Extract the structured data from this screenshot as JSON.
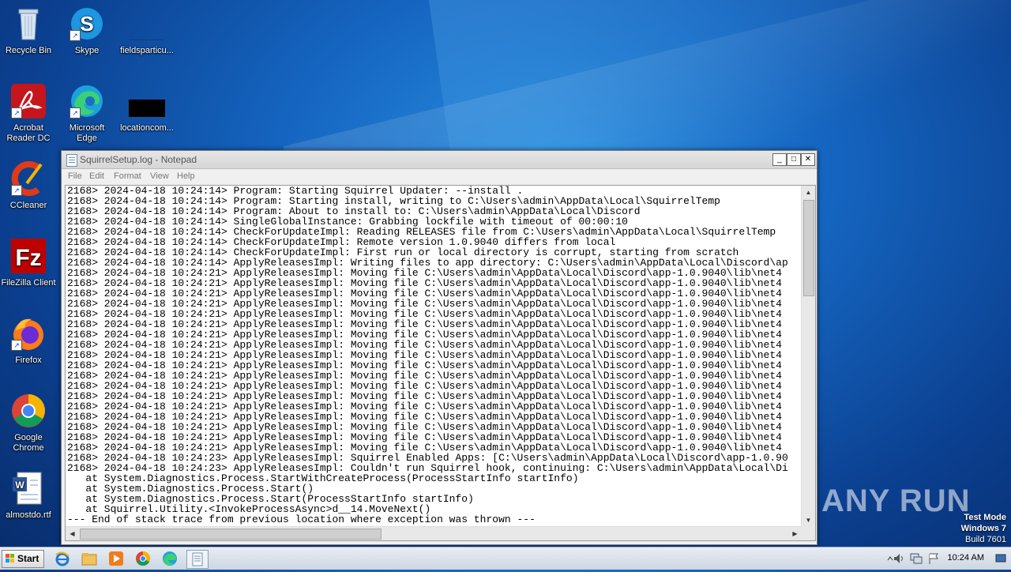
{
  "desktop_icons": [
    {
      "label": "Recycle Bin",
      "icon": "recycle-bin-icon"
    },
    {
      "label": "Skype",
      "icon": "skype-icon"
    },
    {
      "label": "fieldsparticu...",
      "icon": "file-icon"
    },
    {
      "label": "Acrobat Reader DC",
      "icon": "acrobat-icon"
    },
    {
      "label": "Microsoft Edge",
      "icon": "edge-icon"
    },
    {
      "label": "locationcom...",
      "icon": "file-icon"
    },
    {
      "label": "CCleaner",
      "icon": "ccleaner-icon"
    },
    {
      "label": "FileZilla Client",
      "icon": "filezilla-icon"
    },
    {
      "label": "Firefox",
      "icon": "firefox-icon"
    },
    {
      "label": "Google Chrome",
      "icon": "chrome-icon"
    },
    {
      "label": "almostdo.rtf",
      "icon": "word-doc-icon"
    }
  ],
  "notepad": {
    "title": "SquirrelSetup.log - Notepad",
    "menu": [
      "File",
      "Edit",
      "Format",
      "View",
      "Help"
    ],
    "buttons": {
      "minimize": "_",
      "maximize": "□",
      "close": "✕"
    },
    "lines": [
      "2168> 2024-04-18 10:24:14> Program: Starting Squirrel Updater: --install .",
      "2168> 2024-04-18 10:24:14> Program: Starting install, writing to C:\\Users\\admin\\AppData\\Local\\SquirrelTemp",
      "2168> 2024-04-18 10:24:14> Program: About to install to: C:\\Users\\admin\\AppData\\Local\\Discord",
      "2168> 2024-04-18 10:24:14> SingleGlobalInstance: Grabbing lockfile with timeout of 00:00:10",
      "2168> 2024-04-18 10:24:14> CheckForUpdateImpl: Reading RELEASES file from C:\\Users\\admin\\AppData\\Local\\SquirrelTemp",
      "2168> 2024-04-18 10:24:14> CheckForUpdateImpl: Remote version 1.0.9040 differs from local",
      "2168> 2024-04-18 10:24:14> CheckForUpdateImpl: First run or local directory is corrupt, starting from scratch",
      "2168> 2024-04-18 10:24:14> ApplyReleasesImpl: Writing files to app directory: C:\\Users\\admin\\AppData\\Local\\Discord\\ap",
      "2168> 2024-04-18 10:24:21> ApplyReleasesImpl: Moving file C:\\Users\\admin\\AppData\\Local\\Discord\\app-1.0.9040\\lib\\net4",
      "2168> 2024-04-18 10:24:21> ApplyReleasesImpl: Moving file C:\\Users\\admin\\AppData\\Local\\Discord\\app-1.0.9040\\lib\\net4",
      "2168> 2024-04-18 10:24:21> ApplyReleasesImpl: Moving file C:\\Users\\admin\\AppData\\Local\\Discord\\app-1.0.9040\\lib\\net4",
      "2168> 2024-04-18 10:24:21> ApplyReleasesImpl: Moving file C:\\Users\\admin\\AppData\\Local\\Discord\\app-1.0.9040\\lib\\net4",
      "2168> 2024-04-18 10:24:21> ApplyReleasesImpl: Moving file C:\\Users\\admin\\AppData\\Local\\Discord\\app-1.0.9040\\lib\\net4",
      "2168> 2024-04-18 10:24:21> ApplyReleasesImpl: Moving file C:\\Users\\admin\\AppData\\Local\\Discord\\app-1.0.9040\\lib\\net4",
      "2168> 2024-04-18 10:24:21> ApplyReleasesImpl: Moving file C:\\Users\\admin\\AppData\\Local\\Discord\\app-1.0.9040\\lib\\net4",
      "2168> 2024-04-18 10:24:21> ApplyReleasesImpl: Moving file C:\\Users\\admin\\AppData\\Local\\Discord\\app-1.0.9040\\lib\\net4",
      "2168> 2024-04-18 10:24:21> ApplyReleasesImpl: Moving file C:\\Users\\admin\\AppData\\Local\\Discord\\app-1.0.9040\\lib\\net4",
      "2168> 2024-04-18 10:24:21> ApplyReleasesImpl: Moving file C:\\Users\\admin\\AppData\\Local\\Discord\\app-1.0.9040\\lib\\net4",
      "2168> 2024-04-18 10:24:21> ApplyReleasesImpl: Moving file C:\\Users\\admin\\AppData\\Local\\Discord\\app-1.0.9040\\lib\\net4",
      "2168> 2024-04-18 10:24:21> ApplyReleasesImpl: Moving file C:\\Users\\admin\\AppData\\Local\\Discord\\app-1.0.9040\\lib\\net4",
      "2168> 2024-04-18 10:24:21> ApplyReleasesImpl: Moving file C:\\Users\\admin\\AppData\\Local\\Discord\\app-1.0.9040\\lib\\net4",
      "2168> 2024-04-18 10:24:21> ApplyReleasesImpl: Moving file C:\\Users\\admin\\AppData\\Local\\Discord\\app-1.0.9040\\lib\\net4",
      "2168> 2024-04-18 10:24:21> ApplyReleasesImpl: Moving file C:\\Users\\admin\\AppData\\Local\\Discord\\app-1.0.9040\\lib\\net4",
      "2168> 2024-04-18 10:24:21> ApplyReleasesImpl: Moving file C:\\Users\\admin\\AppData\\Local\\Discord\\app-1.0.9040\\lib\\net4",
      "2168> 2024-04-18 10:24:21> ApplyReleasesImpl: Moving file C:\\Users\\admin\\AppData\\Local\\Discord\\app-1.0.9040\\lib\\net4",
      "2168> 2024-04-18 10:24:21> ApplyReleasesImpl: Moving file C:\\Users\\admin\\AppData\\Local\\Discord\\app-1.0.9040\\lib\\net4",
      "2168> 2024-04-18 10:24:23> ApplyReleasesImpl: Squirrel Enabled Apps: [C:\\Users\\admin\\AppData\\Local\\Discord\\app-1.0.90",
      "2168> 2024-04-18 10:24:23> ApplyReleasesImpl: Couldn't run Squirrel hook, continuing: C:\\Users\\admin\\AppData\\Local\\Di",
      "   at System.Diagnostics.Process.StartWithCreateProcess(ProcessStartInfo startInfo)",
      "   at System.Diagnostics.Process.Start()",
      "   at System.Diagnostics.Process.Start(ProcessStartInfo startInfo)",
      "   at Squirrel.Utility.<InvokeProcessAsync>d__14.MoveNext()",
      "--- End of stack trace from previous location where exception was thrown ---"
    ]
  },
  "taskbar": {
    "start_label": "Start",
    "apps": [
      "ie-icon",
      "explorer-icon",
      "media-player-icon",
      "chrome-icon",
      "edge-icon",
      "notepad-icon"
    ],
    "clock": "10:24 AM"
  },
  "watermark": "ANY RUN",
  "testmode": {
    "line1": "Test Mode",
    "line2": "Windows 7",
    "line3": "Build 7601"
  }
}
